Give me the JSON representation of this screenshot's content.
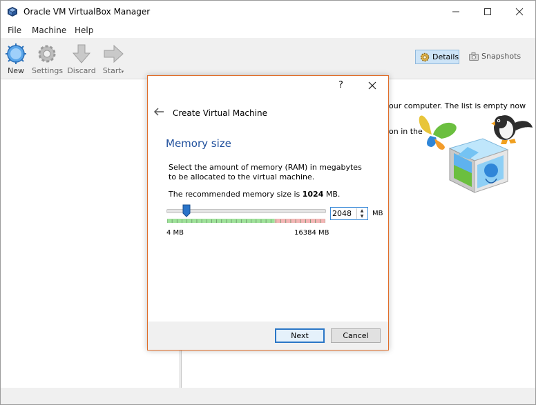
{
  "window": {
    "title": "Oracle VM VirtualBox Manager"
  },
  "menu": [
    "File",
    "Machine",
    "Help"
  ],
  "toolbar": {
    "new": "New",
    "settings": "Settings",
    "discard": "Discard",
    "start": "Start"
  },
  "view_toggle": {
    "details": "Details",
    "snapshots": "Snapshots"
  },
  "welcome": {
    "line1": "our computer. The list is empty now",
    "line2": "on in the"
  },
  "dialog": {
    "help": "?",
    "heading": "Create Virtual Machine",
    "title": "Memory size",
    "description": "Select the amount of memory (RAM) in megabytes to be allocated to the virtual machine.",
    "recommended_prefix": "The recommended memory size is ",
    "recommended_value": "1024",
    "recommended_suffix": " MB.",
    "memory_value": "2048",
    "unit": "MB",
    "min_label": "4 MB",
    "max_label": "16384 MB",
    "slider": {
      "min": 4,
      "max": 16384,
      "value": 2048
    },
    "next": "Next",
    "cancel": "Cancel"
  },
  "colors": {
    "accent": "#1f4f9c",
    "dialog_border": "#e06d28",
    "slider_ok": "#9fe29a",
    "slider_warn": "#f4b6b6"
  }
}
